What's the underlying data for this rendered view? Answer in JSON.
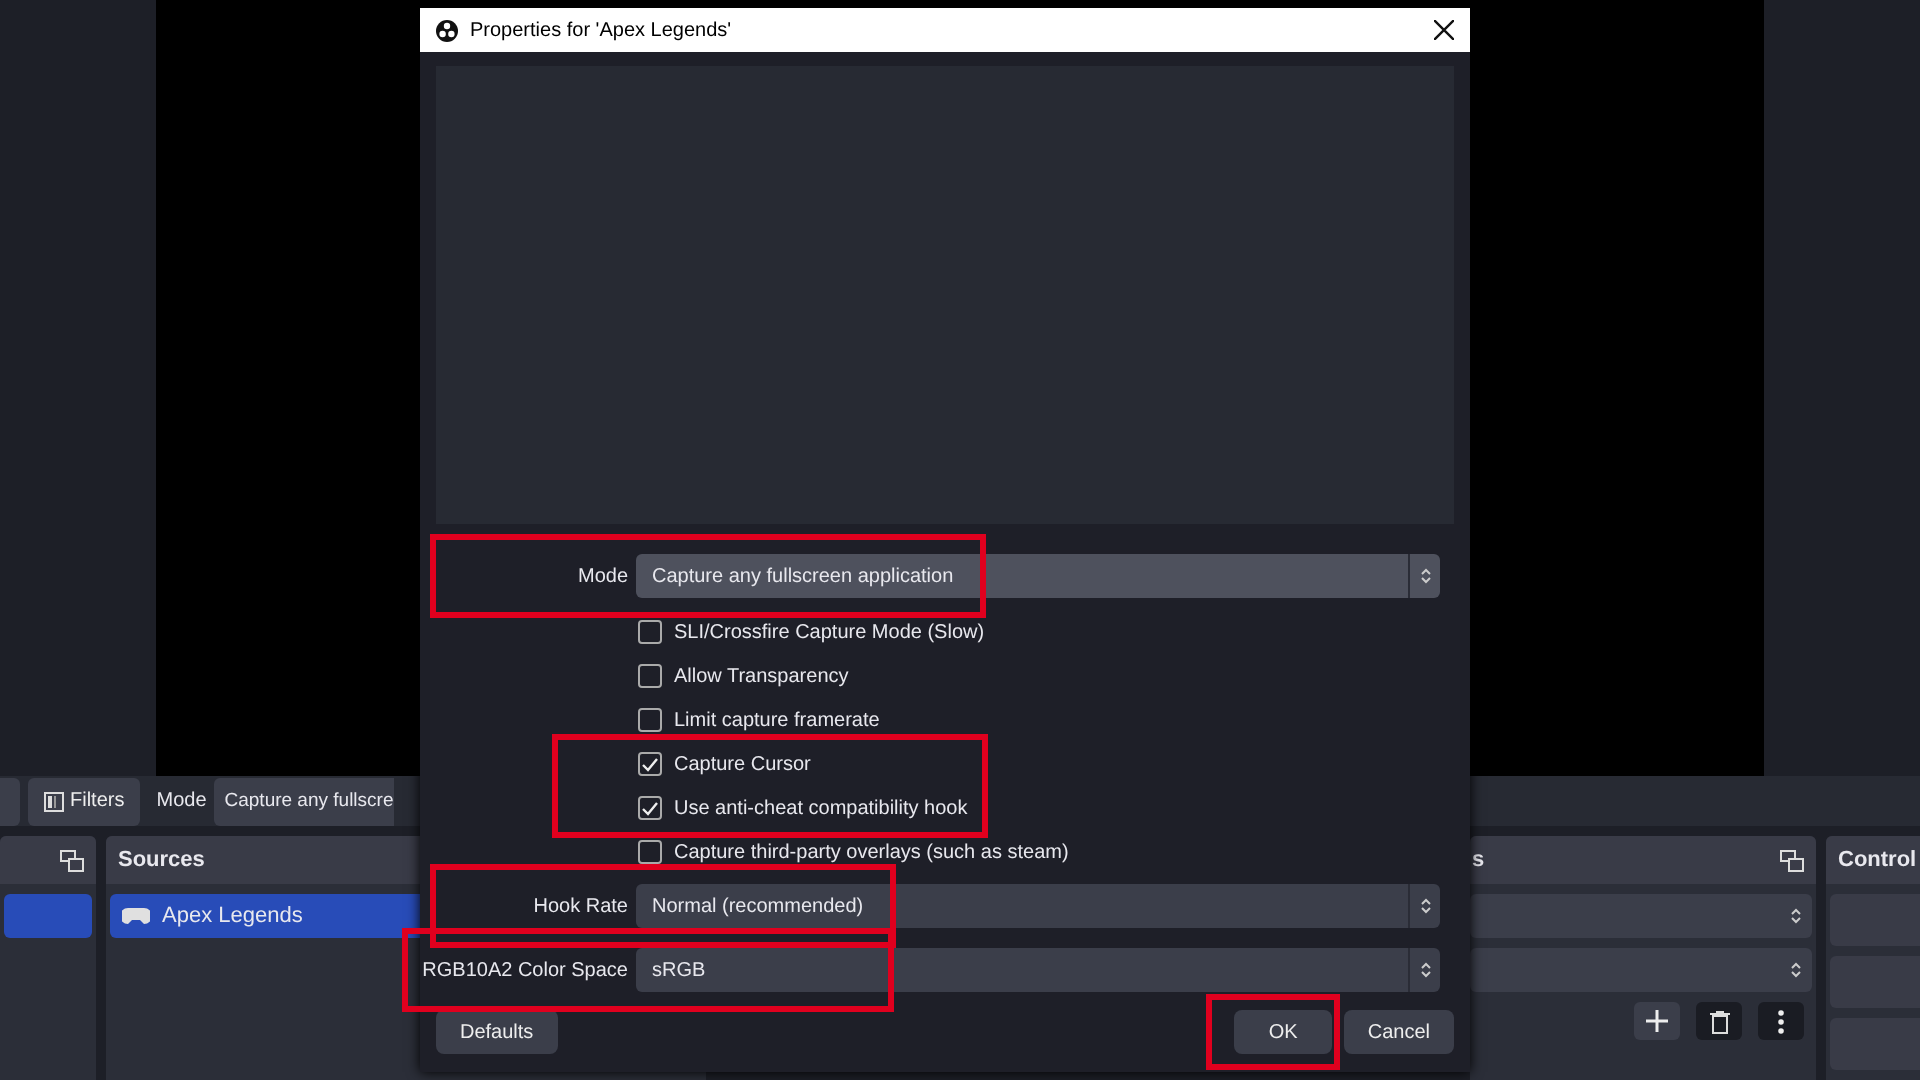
{
  "main_window": {
    "toolbar": {
      "filters_button": "Filters",
      "mode_label": "Mode",
      "mode_value": "Capture any fullscre"
    },
    "docks": [
      {
        "kind": "scenes",
        "items": [
          {
            "selected": true
          }
        ]
      },
      {
        "kind": "sources",
        "title": "Sources",
        "items": [
          {
            "label": "Apex Legends",
            "selected": true
          }
        ]
      },
      {
        "kind": "mixer",
        "title": "s"
      },
      {
        "kind": "controls",
        "title": "Control"
      }
    ]
  },
  "dialog": {
    "title": "Properties for 'Apex Legends'",
    "properties": [
      {
        "kind": "select",
        "label": "Mode",
        "value": "Capture any fullscreen application",
        "focused": true,
        "highlighted": true
      },
      {
        "kind": "checkbox",
        "label": "SLI/Crossfire Capture Mode (Slow)",
        "checked": false,
        "highlighted": false
      },
      {
        "kind": "checkbox",
        "label": "Allow Transparency",
        "checked": false,
        "highlighted": false
      },
      {
        "kind": "checkbox",
        "label": "Limit capture framerate",
        "checked": false,
        "highlighted": false
      },
      {
        "kind": "checkbox",
        "label": "Capture Cursor",
        "checked": true,
        "highlighted": true
      },
      {
        "kind": "checkbox",
        "label": "Use anti-cheat compatibility hook",
        "checked": true,
        "highlighted": true
      },
      {
        "kind": "checkbox",
        "label": "Capture third-party overlays (such as steam)",
        "checked": false,
        "highlighted": false
      },
      {
        "kind": "select",
        "label": "Hook Rate",
        "value": "Normal (recommended)",
        "focused": false,
        "highlighted": true
      },
      {
        "kind": "select",
        "label": "RGB10A2 Color Space",
        "value": "sRGB",
        "focused": false,
        "highlighted": true
      }
    ],
    "buttons": [
      {
        "kind": "defaults",
        "label": "Defaults",
        "highlighted": false
      },
      {
        "kind": "ok",
        "label": "OK",
        "highlighted": true
      },
      {
        "kind": "cancel",
        "label": "Cancel",
        "highlighted": false
      }
    ]
  }
}
